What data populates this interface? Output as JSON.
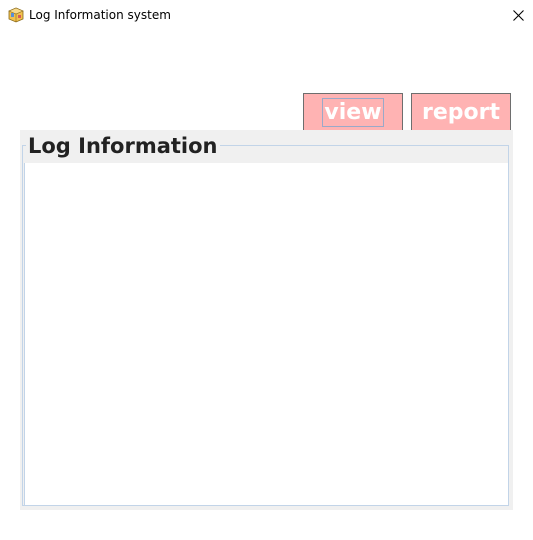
{
  "window": {
    "title": "Log Information system",
    "icon": "app-package-icon",
    "close_icon": "close-icon"
  },
  "toolbar": {
    "view_label": "view",
    "report_label": "report",
    "button_color": "#ffb3b3"
  },
  "log_group": {
    "title": "Log Information",
    "content": ""
  }
}
